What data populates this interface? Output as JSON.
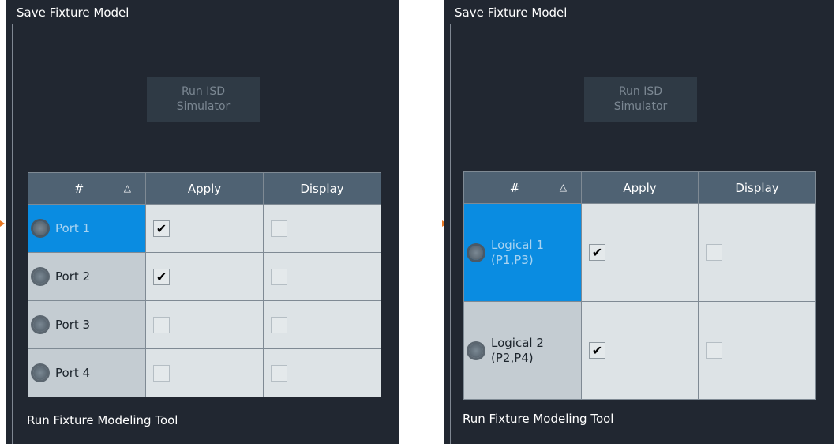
{
  "panels": [
    {
      "title": "Save Fixture Model",
      "run_isd": [
        "Run ISD",
        "Simulator"
      ],
      "table": {
        "headers": {
          "num": "#",
          "apply": "Apply",
          "display": "Display"
        },
        "rows": [
          {
            "label": "Port 1",
            "selected": true,
            "apply": true,
            "display": false
          },
          {
            "label": "Port 2",
            "selected": false,
            "apply": true,
            "display": false
          },
          {
            "label": "Port 3",
            "selected": false,
            "apply": false,
            "display": false
          },
          {
            "label": "Port 4",
            "selected": false,
            "apply": false,
            "display": false
          }
        ]
      },
      "footer": "Run Fixture Modeling Tool"
    },
    {
      "title": "Save Fixture Model",
      "run_isd": [
        "Run ISD",
        "Simulator"
      ],
      "table": {
        "headers": {
          "num": "#",
          "apply": "Apply",
          "display": "Display"
        },
        "rows": [
          {
            "label": [
              "Logical 1",
              "(P1,P3)"
            ],
            "selected": true,
            "apply": true,
            "display": false
          },
          {
            "label": [
              "Logical 2",
              "(P2,P4)"
            ],
            "selected": false,
            "apply": true,
            "display": false
          }
        ]
      },
      "footer": "Run Fixture Modeling Tool"
    }
  ],
  "icons": {
    "sort": "sort-ascending-icon",
    "check": "checkmark-icon",
    "port": "port-connector-icon"
  },
  "colors": {
    "panel": "#212731",
    "header": "#4f6273",
    "selected": "#0a8ce1",
    "accent_mark": "#e87722"
  }
}
